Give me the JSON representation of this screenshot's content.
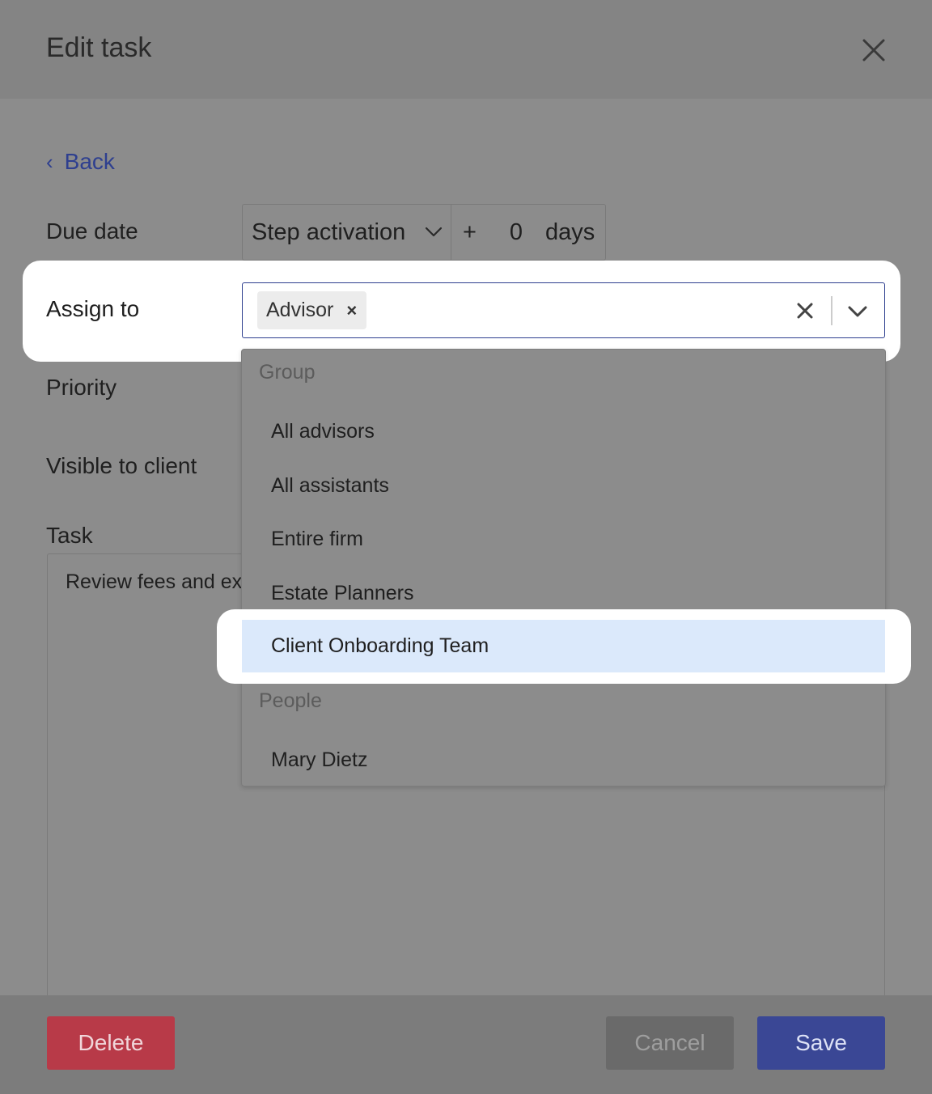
{
  "dialog": {
    "title": "Edit task",
    "back_label": "Back"
  },
  "form": {
    "due_date_label": "Due date",
    "due_date_trigger": "Step activation",
    "due_date_plus": "+",
    "due_date_offset": "0",
    "due_date_unit": "days",
    "assign_to_label": "Assign to",
    "assign_to_chip": "Advisor",
    "priority_label": "Priority",
    "visible_label": "Visible to client",
    "task_label": "Task",
    "task_text": "Review fees and exp"
  },
  "dropdown": {
    "groups": [
      {
        "heading": "Group",
        "options": [
          "All advisors",
          "All assistants",
          "Entire firm",
          "Estate Planners",
          "Client Onboarding Team"
        ]
      },
      {
        "heading": "People",
        "options": [
          "Mary Dietz"
        ]
      }
    ],
    "highlighted_option": "Client Onboarding Team"
  },
  "footer": {
    "delete_label": "Delete",
    "cancel_label": "Cancel",
    "save_label": "Save"
  },
  "colors": {
    "accent": "#3a4795",
    "danger": "#b83a48",
    "highlight": "#dbe9fb"
  }
}
